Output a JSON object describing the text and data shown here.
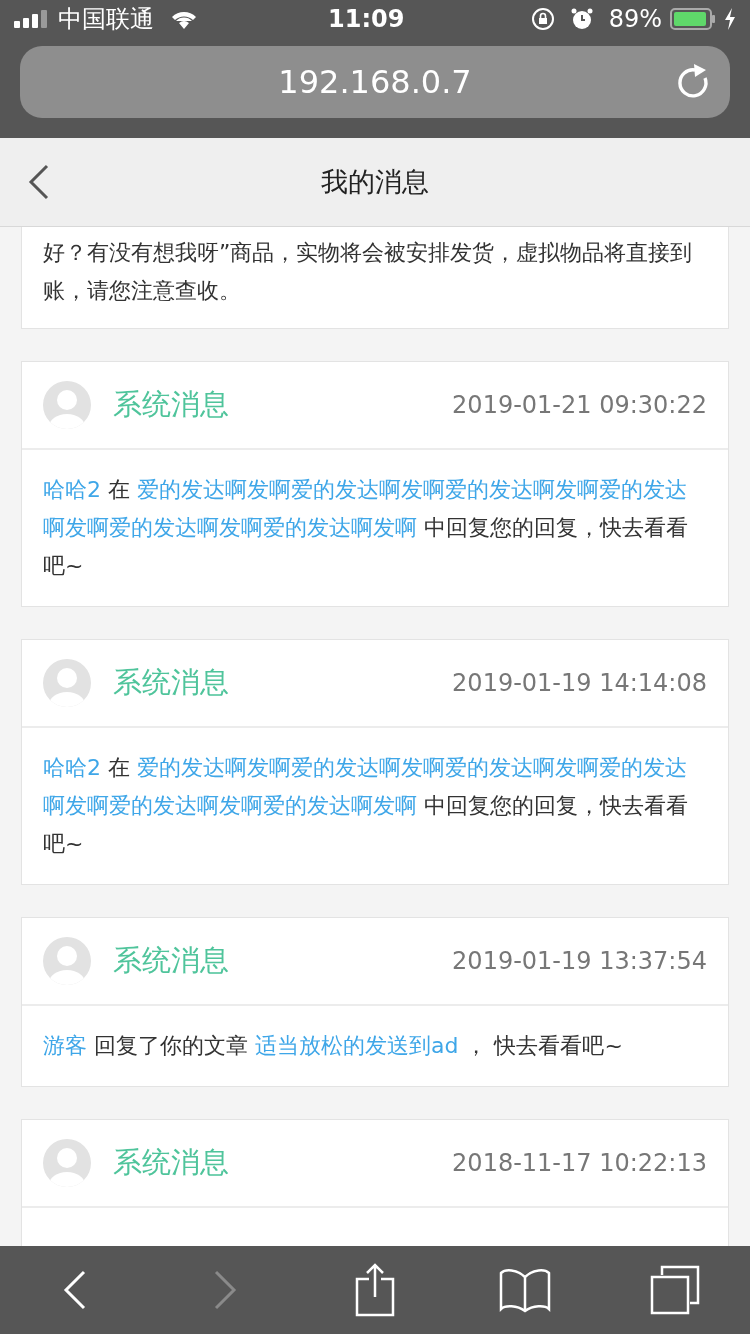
{
  "status_bar": {
    "carrier": "中国联通",
    "time": "11:09",
    "battery_text": "89%"
  },
  "address_bar": {
    "url": "192.168.0.7"
  },
  "header": {
    "title": "我的消息"
  },
  "messages": [
    {
      "body": [
        {
          "text": "好？有没有想我呀”商品，实物将会被安排发货，虚拟物品将直接到账，请您注意查收。",
          "link": false
        }
      ]
    },
    {
      "sender": "系统消息",
      "time": "2019-01-21 09:30:22",
      "body": [
        {
          "text": "哈哈2",
          "link": true
        },
        {
          "text": " 在 ",
          "link": false
        },
        {
          "text": "爱的发达啊发啊爱的发达啊发啊爱的发达啊发啊爱的发达啊发啊爱的发达啊发啊爱的发达啊发啊",
          "link": true
        },
        {
          "text": " 中回复您的回复，快去看看吧~",
          "link": false
        }
      ]
    },
    {
      "sender": "系统消息",
      "time": "2019-01-19 14:14:08",
      "body": [
        {
          "text": "哈哈2",
          "link": true
        },
        {
          "text": " 在 ",
          "link": false
        },
        {
          "text": "爱的发达啊发啊爱的发达啊发啊爱的发达啊发啊爱的发达啊发啊爱的发达啊发啊爱的发达啊发啊",
          "link": true
        },
        {
          "text": " 中回复您的回复，快去看看吧~",
          "link": false
        }
      ]
    },
    {
      "sender": "系统消息",
      "time": "2019-01-19 13:37:54",
      "body": [
        {
          "text": "游客",
          "link": true
        },
        {
          "text": " 回复了你的文章 ",
          "link": false
        },
        {
          "text": "适当放松的发送到ad",
          "link": true
        },
        {
          "text": " ， 快去看看吧~",
          "link": false
        }
      ]
    },
    {
      "sender": "系统消息",
      "time": "2018-11-17 10:22:13"
    }
  ],
  "toolbar": {
    "back_disabled": false,
    "forward_disabled": true
  }
}
